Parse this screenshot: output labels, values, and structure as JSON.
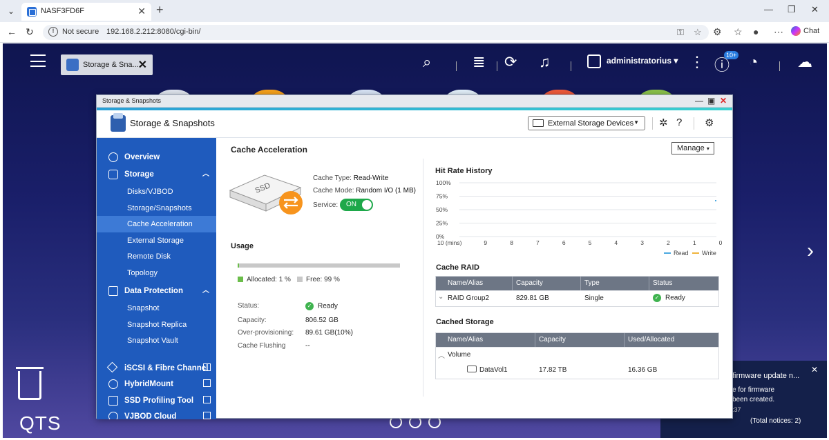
{
  "browser": {
    "tab_title": "NASF3FD6F",
    "not_secure": "Not secure",
    "url": "192.168.2.212:8080/cgi-bin/",
    "chat_label": "Chat"
  },
  "desktop": {
    "open_app_tab": "Storage & Sna...",
    "username": "administratorius",
    "notification_badge": "10+",
    "qts_label": "QTS",
    "toast": {
      "title": "firmware update n...",
      "line1": "e for firmware",
      "line2": "been created.",
      "time": ":37",
      "total": "(Total notices: 2)"
    }
  },
  "window": {
    "title_bar": "Storage & Snapshots",
    "app_title": "Storage & Snapshots",
    "external_devices": "External Storage Devices"
  },
  "sidebar": {
    "overview": "Overview",
    "storage": "Storage",
    "disks": "Disks/VJBOD",
    "storage_snapshots": "Storage/Snapshots",
    "cache_acceleration": "Cache Acceleration",
    "external_storage": "External Storage",
    "remote_disk": "Remote Disk",
    "topology": "Topology",
    "data_protection": "Data Protection",
    "snapshot": "Snapshot",
    "snapshot_replica": "Snapshot Replica",
    "snapshot_vault": "Snapshot Vault",
    "iscsi": "iSCSI & Fibre Channel",
    "hybridmount": "HybridMount",
    "ssd_profiling": "SSD Profiling Tool",
    "vjbod_cloud": "VJBOD Cloud"
  },
  "main": {
    "heading": "Cache Acceleration",
    "manage": "Manage",
    "ssd_label": "SSD",
    "cache_type_label": "Cache Type:",
    "cache_type": "Read-Write",
    "cache_mode_label": "Cache Mode:",
    "cache_mode": "Random I/O (1 MB)",
    "service_label": "Service:",
    "service_state": "ON",
    "usage_heading": "Usage",
    "allocated_fraction": 0.01,
    "allocated_legend": "Allocated: 1 %",
    "free_legend": "Free: 99 %",
    "status_label": "Status:",
    "status_value": "Ready",
    "capacity_label": "Capacity:",
    "capacity_value": "806.52 GB",
    "overprov_label": "Over-provisioning:",
    "overprov_value": "89.61 GB(10%)",
    "flushing_label": "Cache Flushing",
    "flushing_value": "--",
    "hit_rate_heading": "Hit Rate History",
    "chart_y_ticks": [
      "100%",
      "75%",
      "50%",
      "25%",
      "0%"
    ],
    "chart_x_ticks": [
      "10 (mins)",
      "9",
      "8",
      "7",
      "6",
      "5",
      "4",
      "3",
      "2",
      "1",
      "0"
    ],
    "legend_read": "Read",
    "legend_write": "Write",
    "cache_raid_heading": "Cache RAID",
    "raid_headers": [
      "Name/Alias",
      "Capacity",
      "Type",
      "Status"
    ],
    "raid_row": {
      "name": "RAID Group2",
      "capacity": "829.81 GB",
      "type": "Single",
      "status": "Ready"
    },
    "cached_storage_heading": "Cached Storage",
    "cached_headers": [
      "Name/Alias",
      "Capacity",
      "Used/Allocated"
    ],
    "pool": "Volume",
    "vol_row": {
      "name": "DataVol1",
      "capacity": "17.82 TB",
      "used": "16.36 GB"
    }
  },
  "colors": {
    "accent": "#1f5bbd",
    "ok": "#3fb34f",
    "read": "#4aa8e0",
    "write": "#f0b43c"
  }
}
